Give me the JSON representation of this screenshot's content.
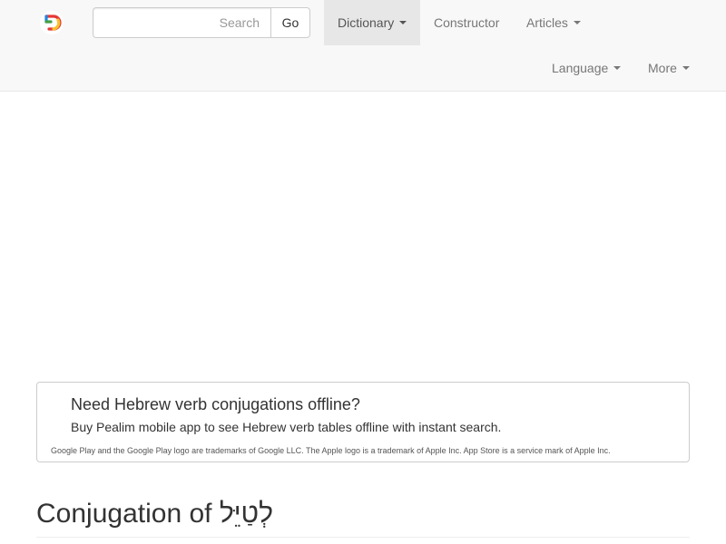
{
  "navbar": {
    "logo_alt": "Pealim logo",
    "search": {
      "placeholder": "Search",
      "value": "",
      "button_label": "Go"
    },
    "items": [
      {
        "label": "Dictionary",
        "dropdown": true,
        "active": true
      },
      {
        "label": "Constructor",
        "dropdown": false,
        "active": false
      },
      {
        "label": "Articles",
        "dropdown": true,
        "active": false
      },
      {
        "label": "Language",
        "dropdown": true,
        "active": false
      },
      {
        "label": "More",
        "dropdown": true,
        "active": false
      }
    ]
  },
  "promo": {
    "title": "Need Hebrew verb conjugations offline?",
    "text": "Buy Pealim mobile app to see Hebrew verb tables offline with instant search.",
    "note": "Google Play and the Google Play logo are trademarks of Google LLC. The Apple logo is a trademark of Apple Inc. App Store is a service mark of Apple Inc."
  },
  "page": {
    "title_prefix": "Conjugation of ",
    "title_word": "לְטַיֵּל"
  },
  "colors": {
    "navbar_bg": "#f8f8f8",
    "nav_active_bg": "#e7e7e7",
    "nav_text": "#777777",
    "logo_colors": [
      "#e53935",
      "#fbc02d",
      "#1e88e5",
      "#43a047"
    ]
  }
}
